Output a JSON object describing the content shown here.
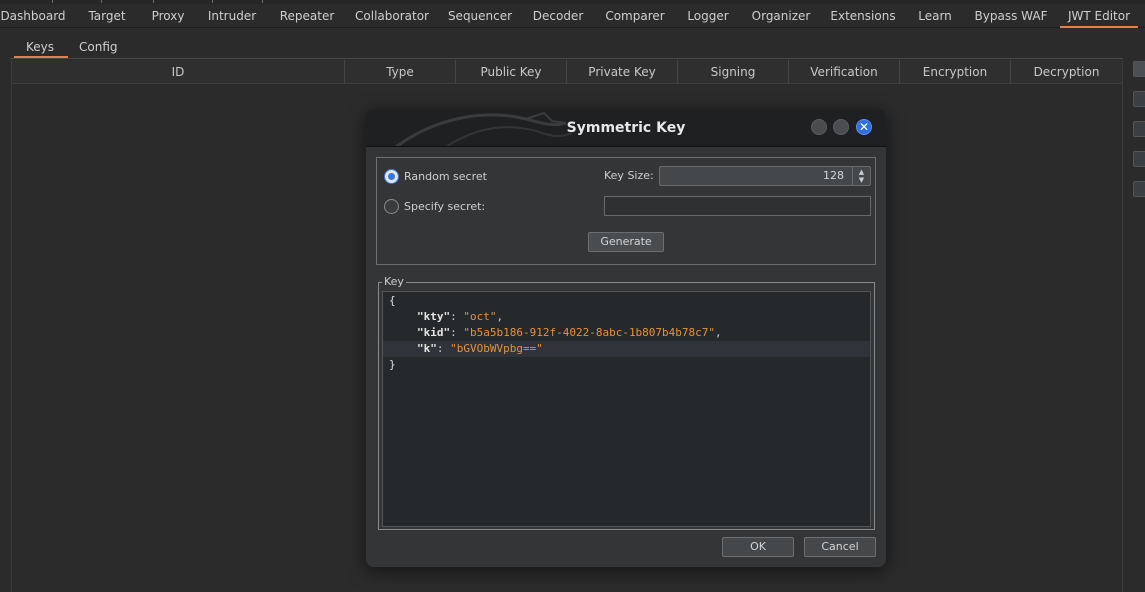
{
  "main_tabs": {
    "items": [
      {
        "label": "Dashboard"
      },
      {
        "label": "Target"
      },
      {
        "label": "Proxy"
      },
      {
        "label": "Intruder"
      },
      {
        "label": "Repeater"
      },
      {
        "label": "Collaborator"
      },
      {
        "label": "Sequencer"
      },
      {
        "label": "Decoder"
      },
      {
        "label": "Comparer"
      },
      {
        "label": "Logger"
      },
      {
        "label": "Organizer"
      },
      {
        "label": "Extensions"
      },
      {
        "label": "Learn"
      },
      {
        "label": "Bypass WAF"
      },
      {
        "label": "JWT Editor"
      }
    ],
    "active": "JWT Editor"
  },
  "sub_tabs": {
    "items": [
      {
        "label": "Keys"
      },
      {
        "label": "Config"
      }
    ],
    "active": "Keys"
  },
  "keys_table": {
    "columns": [
      "ID",
      "Type",
      "Public Key",
      "Private Key",
      "Signing",
      "Verification",
      "Encryption",
      "Decryption"
    ],
    "rows": []
  },
  "dialog": {
    "title": "Symmetric Key",
    "random_secret_label": "Random secret",
    "random_secret_selected": true,
    "specify_secret_label": "Specify secret:",
    "specify_secret_selected": false,
    "specify_secret_value": "",
    "key_size_label": "Key Size:",
    "key_size_value": "128",
    "generate_label": "Generate",
    "key_group_label": "Key",
    "key_json": {
      "open": "{",
      "close": "}",
      "kty_key": "\"kty\"",
      "kty_value": "\"oct\"",
      "kid_key": "\"kid\"",
      "kid_value": "\"b5a5b186-912f-4022-8abc-1b807b4b78c7\"",
      "k_key": "\"k\"",
      "k_value": "\"bGVObWVpbg==\""
    },
    "ok_label": "OK",
    "cancel_label": "Cancel"
  },
  "colors": {
    "accent": "#e4804b",
    "json_string": "#e8913a",
    "close_button": "#2f6fe0",
    "radio_selected": "#3774d8"
  }
}
